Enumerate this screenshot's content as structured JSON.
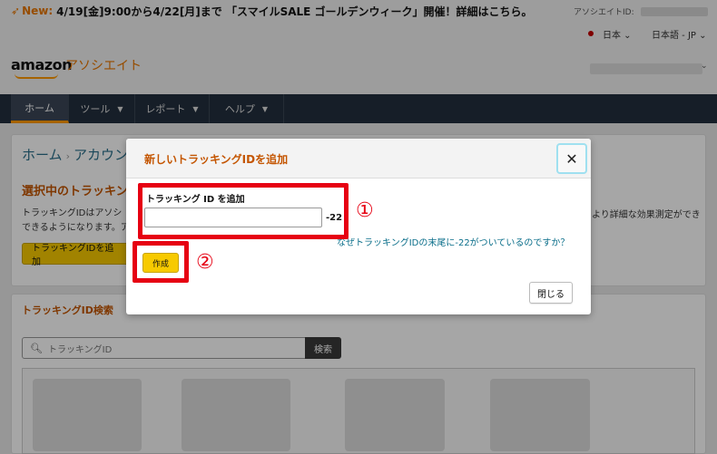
{
  "banner": {
    "badge": "New:",
    "message": "4/19[金]9:00から4/22[月]まで 「スマイルSALE ゴールデンウィーク」開催！詳細はこちら。",
    "associate_id_label": "アソシエイトID:"
  },
  "locale": {
    "country": "日本 ⌄",
    "language": "日本語 - JP ⌄"
  },
  "header": {
    "logo_text": "amazon",
    "logo_sub": "アソシエイト"
  },
  "nav": {
    "items": [
      {
        "label": "ホーム"
      },
      {
        "label": "ツール"
      },
      {
        "label": "レポート"
      },
      {
        "label": "ヘルプ"
      }
    ]
  },
  "page": {
    "breadcrumb_home": "ホーム",
    "breadcrumb_sep": "›",
    "breadcrumb_account": "アカウン",
    "section_title": "選択中のトラッキン",
    "section_text": "トラッキングIDはアソシ できるようになります。ア",
    "section_text_right": "より詳細な効果測定ができ",
    "add_button": "トラッキングIDを追加",
    "search_title": "トラッキングID検索",
    "search_placeholder": "トラッキングID",
    "search_button": "検索"
  },
  "modal": {
    "title": "新しいトラッキングIDを追加",
    "close_symbol": "✕",
    "field_label": "トラッキング ID を追加",
    "field_value": "",
    "suffix": "-22",
    "help_link": "なぜトラッキングIDの末尾に-22がついているのですか？",
    "create_button": "作成",
    "close_button": "閉じる"
  },
  "annotations": {
    "one": "①",
    "two": "②",
    "color": "#e60012"
  }
}
